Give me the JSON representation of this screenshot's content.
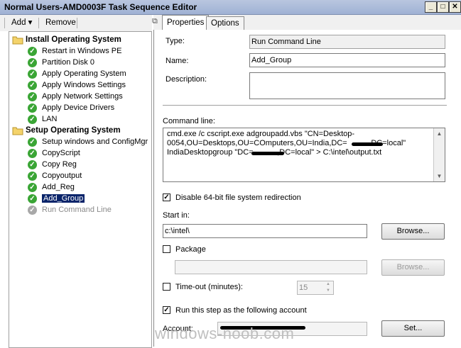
{
  "window": {
    "title": "Normal Users-AMD0003F Task Sequence Editor",
    "minimize": "_",
    "maximize": "□",
    "close": "✕"
  },
  "toolbar": {
    "add_label": "Add ▾",
    "remove_label": "Remove"
  },
  "tree": {
    "groups": [
      {
        "label": "Install Operating System",
        "items": [
          "Restart in Windows PE",
          "Partition Disk 0",
          "Apply Operating System",
          "Apply Windows Settings",
          "Apply Network Settings",
          "Apply Device Drivers",
          "LAN"
        ]
      },
      {
        "label": "Setup Operating System",
        "items": [
          "Setup windows and ConfigMgr",
          "CopyScript",
          "Copy Reg",
          "Copyoutput",
          "Add_Reg",
          "Add_Group",
          "Run Command Line"
        ]
      }
    ],
    "selected": "Add_Group",
    "disabled": "Run Command Line"
  },
  "tabs": {
    "properties": "Properties",
    "options": "Options"
  },
  "properties": {
    "type_label": "Type:",
    "type_value": "Run Command Line",
    "name_label": "Name:",
    "name_value": "Add_Group",
    "description_label": "Description:",
    "description_value": "",
    "command_label": "Command line:",
    "command_value": "cmd.exe /c cscript.exe adgroupadd.vbs \"CN=Desktop-\n0054,OU=Desktops,OU=COmputers,OU=India,DC=           DC=local\"\nIndiaDesktopgroup \"DC=           ,DC=local\" > C:\\intel\\output.txt",
    "disable64_label": "Disable 64-bit file system redirection",
    "disable64_checked": true,
    "startin_label": "Start in:",
    "startin_value": "c:\\intel\\",
    "browse1_label": "Browse...",
    "package_label": "Package",
    "package_checked": false,
    "package_value": "",
    "browse2_label": "Browse...",
    "timeout_label": "Time-out (minutes):",
    "timeout_checked": false,
    "timeout_value": "15",
    "runas_label": "Run this step as the following account",
    "runas_checked": true,
    "account_label": "Account:",
    "account_value": "",
    "set_label": "Set..."
  },
  "watermark": "windows-noob.com",
  "colors": {
    "selection": "#0a246a",
    "check_green": "#3aa535",
    "titlebar": "#a9b9d8"
  }
}
